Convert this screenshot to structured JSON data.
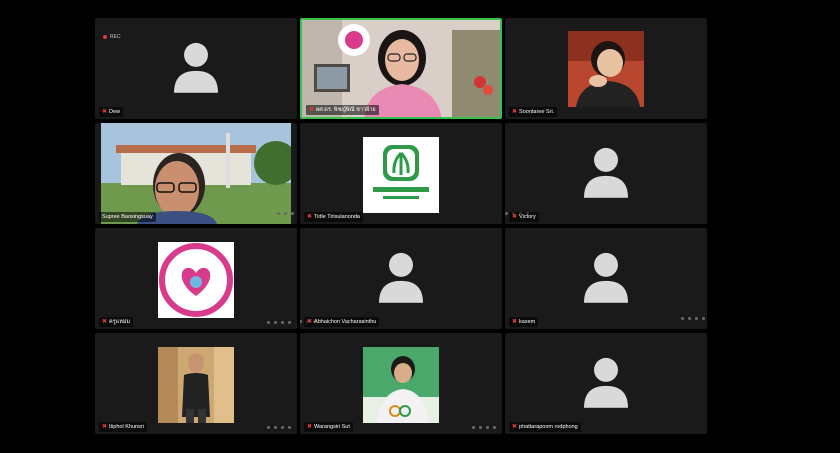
{
  "recording": {
    "label": "REC"
  },
  "colors": {
    "active_border": "#36c24a",
    "mic_muted": "#e23b3b",
    "tile_bg": "#1a1a1a"
  },
  "participants": [
    {
      "name": "Dew",
      "muted": true,
      "video": "off"
    },
    {
      "name": "ผศ.ดร. พิชญ์พิณี ชาวฝ้าย",
      "muted": true,
      "video": "on",
      "active_speaker": true
    },
    {
      "name": "Soontaree Sri.",
      "muted": true,
      "video": "on"
    },
    {
      "name": "Supree Baosingsuay",
      "muted": false,
      "video": "on"
    },
    {
      "name": "Tidle Tirisulanonda",
      "muted": true,
      "video": "logo"
    },
    {
      "name": "Victory",
      "muted": true,
      "video": "off"
    },
    {
      "name": "ครูแหม่ม",
      "muted": true,
      "video": "logo"
    },
    {
      "name": "Abhaichon Vacharasinthu",
      "muted": true,
      "video": "off"
    },
    {
      "name": "kasem",
      "muted": true,
      "video": "off"
    },
    {
      "name": "Itiphol Khunsri",
      "muted": true,
      "video": "on"
    },
    {
      "name": "Warangsiri Sut",
      "muted": true,
      "video": "on"
    },
    {
      "name": "phattarapoom rodphong",
      "muted": true,
      "video": "off"
    }
  ]
}
